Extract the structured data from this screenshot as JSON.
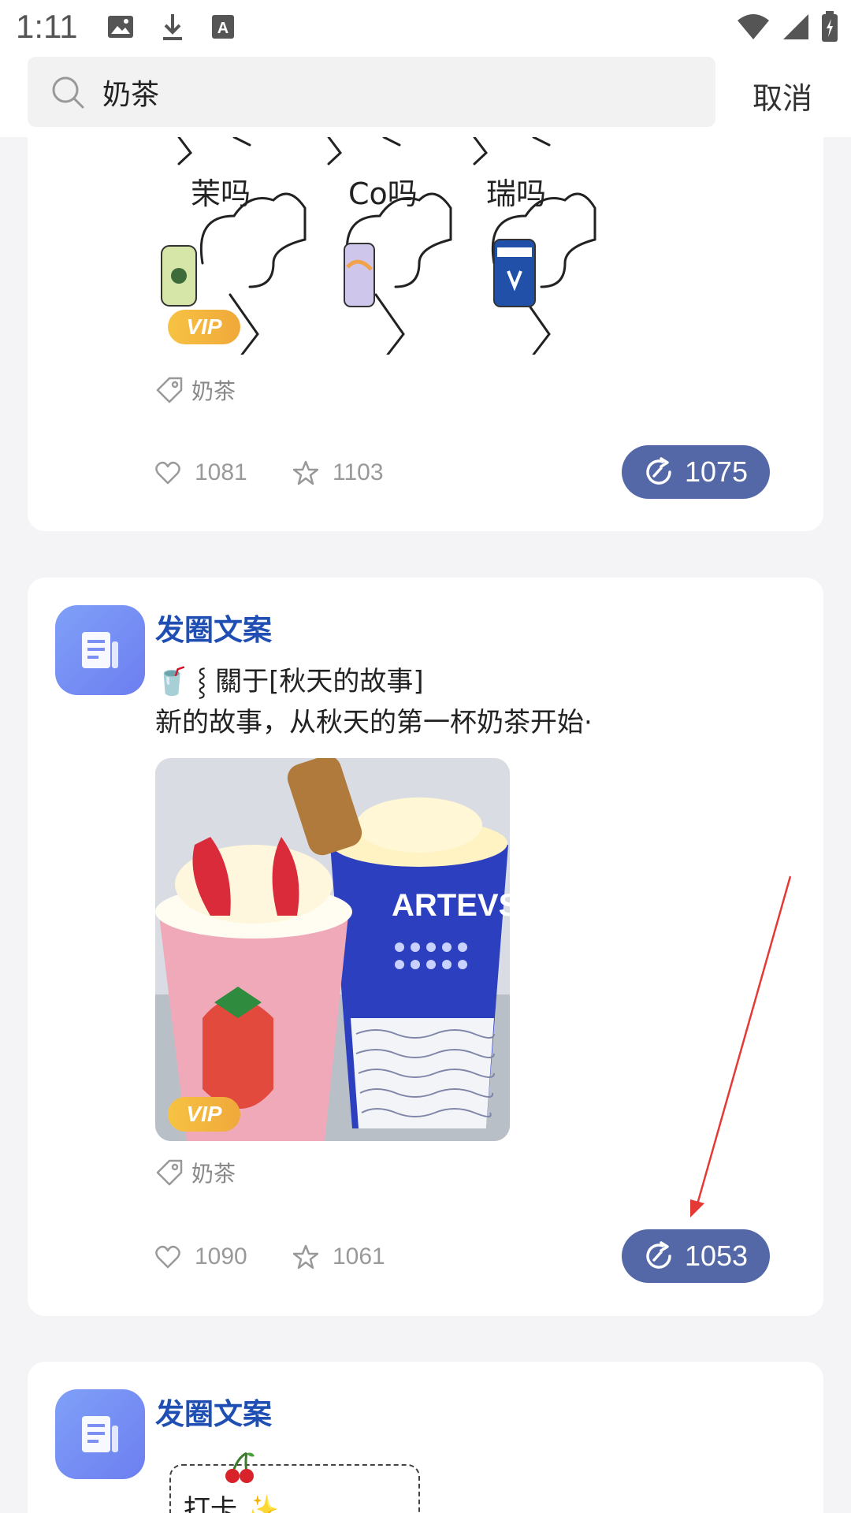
{
  "status_bar": {
    "time": "1:11"
  },
  "search": {
    "query": "奶茶",
    "cancel_label": "取消"
  },
  "posts": [
    {
      "vip": "VIP",
      "tag": "奶茶",
      "likes": "1081",
      "favorites": "1103",
      "uses": "1075",
      "image_captions": [
        "茉吗",
        "Co吗",
        "瑞吗"
      ]
    },
    {
      "author": "发圈文案",
      "text_line1": "🥤 ⸾ 關于[秋天的故事]",
      "text_line2": "新的故事，从秋天的第一杯奶茶开始·",
      "vip": "VIP",
      "tag": "奶茶",
      "likes": "1090",
      "favorites": "1061",
      "uses": "1053",
      "cup_brand": "ARTEVS"
    },
    {
      "author": "发圈文案",
      "preview_text": "打卡 ✨"
    }
  ],
  "colors": {
    "author": "#1f4fb3",
    "use_button": "#5468a8",
    "vip": "#f6c343",
    "annotation": "#e53935"
  }
}
